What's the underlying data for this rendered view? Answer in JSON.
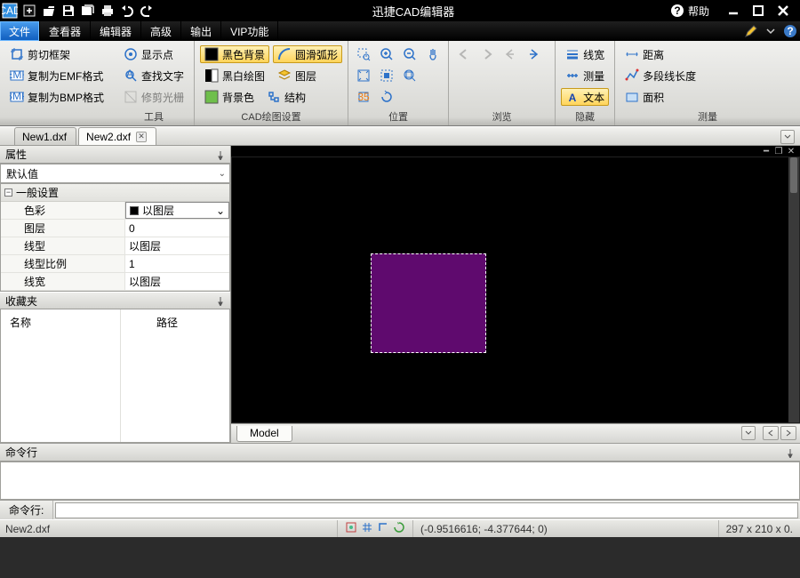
{
  "app": {
    "title": "迅捷CAD编辑器",
    "help": "帮助"
  },
  "menu": {
    "items": [
      "文件",
      "查看器",
      "编辑器",
      "高级",
      "输出",
      "VIP功能"
    ],
    "active": 0
  },
  "ribbon": {
    "groups": [
      {
        "label": "工具",
        "rows": [
          [
            {
              "icon": "crop",
              "text": "剪切框架"
            }
          ],
          [
            {
              "icon": "emf",
              "text": "复制为EMF格式"
            }
          ],
          [
            {
              "icon": "bmp",
              "text": "复制为BMP格式"
            }
          ]
        ]
      },
      {
        "label": "",
        "rows": [
          [
            {
              "icon": "point",
              "text": "显示点"
            }
          ],
          [
            {
              "icon": "find",
              "text": "查找文字"
            }
          ],
          [
            {
              "icon": "trim",
              "text": "修剪光栅",
              "disabled": true
            }
          ]
        ]
      },
      {
        "label": "CAD绘图设置",
        "rows": [
          [
            {
              "icon": "bgk",
              "text": "黑色背景",
              "hl": true
            },
            {
              "icon": "arc",
              "text": "圆滑弧形",
              "hl": true
            }
          ],
          [
            {
              "icon": "bw",
              "text": "黑白绘图"
            },
            {
              "icon": "layer",
              "text": "图层"
            }
          ],
          [
            {
              "icon": "bgc",
              "text": "背景色"
            },
            {
              "icon": "struct",
              "text": "结构"
            }
          ]
        ]
      },
      {
        "label": "位置",
        "rows": [
          [
            {
              "i": "zoomwin"
            },
            {
              "i": "zoomin"
            },
            {
              "i": "zoomout"
            },
            {
              "i": "pan"
            }
          ],
          [
            {
              "i": "fit"
            },
            {
              "i": "extent"
            },
            {
              "i": "zoomall"
            }
          ],
          [
            {
              "i": "sel"
            },
            {
              "i": "rot"
            }
          ]
        ]
      },
      {
        "label": "浏览",
        "rows": [
          [
            {
              "i": "back",
              "dis": true
            },
            {
              "i": "fwd",
              "dis": true
            },
            {
              "i": "home",
              "dis": true
            },
            {
              "i": "view"
            }
          ]
        ]
      },
      {
        "label": "隐藏",
        "rows": [
          [
            {
              "icon": "lw",
              "text": "线宽"
            }
          ],
          [
            {
              "icon": "meas",
              "text": "测量"
            }
          ],
          [
            {
              "icon": "txt",
              "text": "文本",
              "hl": true
            }
          ]
        ]
      },
      {
        "label": "测量",
        "rows": [
          [
            {
              "icon": "dist",
              "text": "距离"
            }
          ],
          [
            {
              "icon": "poly",
              "text": "多段线长度"
            }
          ],
          [
            {
              "icon": "area",
              "text": "面积"
            }
          ]
        ]
      }
    ]
  },
  "tabs": {
    "items": [
      "New1.dxf",
      "New2.dxf"
    ],
    "active": 1
  },
  "props": {
    "title": "属性",
    "dropdown": "默认值",
    "category": "一般设置",
    "rows": [
      {
        "name": "色彩",
        "value": "以图层",
        "swatch": true,
        "combo": true
      },
      {
        "name": "图层",
        "value": "0"
      },
      {
        "name": "线型",
        "value": "以图层"
      },
      {
        "name": "线型比例",
        "value": "1"
      },
      {
        "name": "线宽",
        "value": "以图层"
      }
    ],
    "fav": {
      "title": "收藏夹",
      "cols": [
        "名称",
        "路径"
      ]
    }
  },
  "model": {
    "tab": "Model"
  },
  "cmd": {
    "title": "命令行",
    "prompt": "命令行:"
  },
  "status": {
    "file": "New2.dxf",
    "coord": "(-0.9516616; -4.377644; 0)",
    "dim": "297 x 210 x 0."
  }
}
